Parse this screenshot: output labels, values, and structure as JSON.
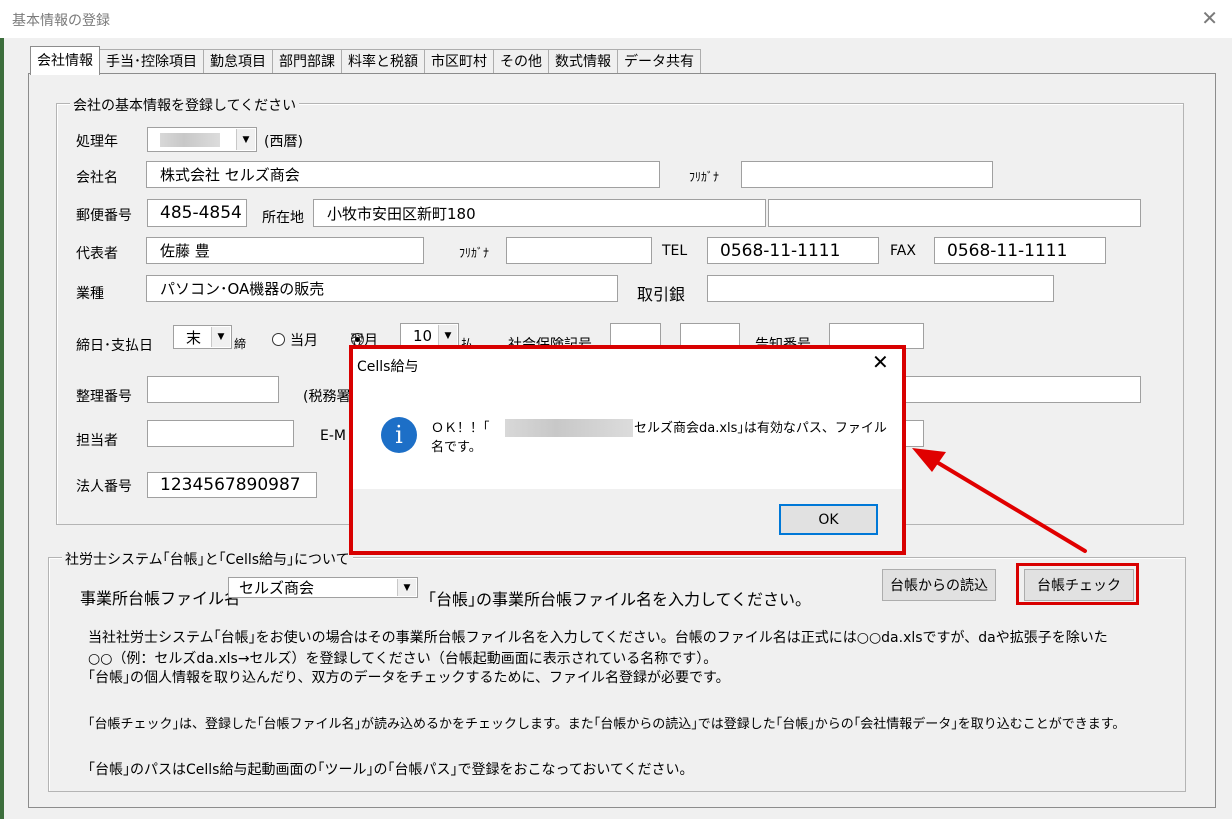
{
  "window": {
    "title": "基本情報の登録"
  },
  "tabs": [
    "会社情報",
    "手当･控除項目",
    "勤怠項目",
    "部門部課",
    "料率と税額",
    "市区町村",
    "その他",
    "数式情報",
    "データ共有"
  ],
  "company": {
    "group_label": "会社の基本情報を登録してください",
    "year_label": "処理年",
    "year_suffix": "(西暦)",
    "name_label": "会社名",
    "name_value": "株式会社 セルズ商会",
    "furigana_label": "ﾌﾘｶﾞﾅ",
    "zip_label": "郵便番号",
    "zip_value": "485-4854",
    "address_label": "所在地",
    "address_value": "小牧市安田区新町180",
    "rep_label": "代表者",
    "rep_value": "佐藤 豊",
    "rep_furigana_label": "ﾌﾘｶﾞﾅ",
    "tel_label": "TEL",
    "tel_value": "0568-11-1111",
    "fax_label": "FAX",
    "fax_value": "0568-11-1111",
    "industry_label": "業種",
    "industry_value": "パソコン･OA機器の販売",
    "bank_label": "取引銀",
    "closing_label": "締日･支払日",
    "closing_value": "末",
    "closing_suffix": "締",
    "radio_current": "当月",
    "radio_next": "翌月",
    "pay_day_value": "10",
    "pay_day_suffix": "払",
    "insurance_label": "社会保険記号",
    "notify_label": "告知番号",
    "ref_label": "整理番号",
    "tax_office_label": "(税務署",
    "staff_label": "担当者",
    "email_label": "E-M",
    "corp_no_label": "法人番号",
    "corp_no_value": "1234567890987"
  },
  "daicho": {
    "group_label": "社労士システム｢台帳｣と｢Cells給与｣について",
    "file_label": "事業所台帳ファイル名",
    "file_value": "セルズ商会",
    "file_hint": "｢台帳｣の事業所台帳ファイル名を入力してください。",
    "read_button": "台帳からの読込",
    "check_button": "台帳チェック",
    "desc": [
      "当社社労士システム｢台帳｣をお使いの場合はその事業所台帳ファイル名を入力してください。台帳のファイル名は正式には○○da.xlsですが、daや拡張子を除いた",
      "○○（例：セルズda.xls→セルズ）を登録してください（台帳起動画面に表示されている名称です）。",
      "｢台帳｣の個人情報を取り込んだり、双方のデータをチェックするために、ファイル名登録が必要です。",
      "｢台帳チェック｣は、登録した｢台帳ファイル名｣が読み込めるかをチェックします。また｢台帳からの読込｣では登録した｢台帳｣からの｢会社情報データ｣を取り込むことができます。",
      "｢台帳｣のパスはCells給与起動画面の｢ツール｣の｢台帳パス｣で登録をおこなっておいてください。"
    ]
  },
  "dialog": {
    "title": "Cells給与",
    "msg_prefix": "ＯＫ！！｢",
    "msg_mid": "セルズ商会da.xls｣は有効なパス、ファイル",
    "msg_line2": "名です。",
    "ok": "OK"
  },
  "colors": {
    "highlight": "#d80000",
    "info": "#1d6fc7",
    "focus": "#0078d7"
  }
}
